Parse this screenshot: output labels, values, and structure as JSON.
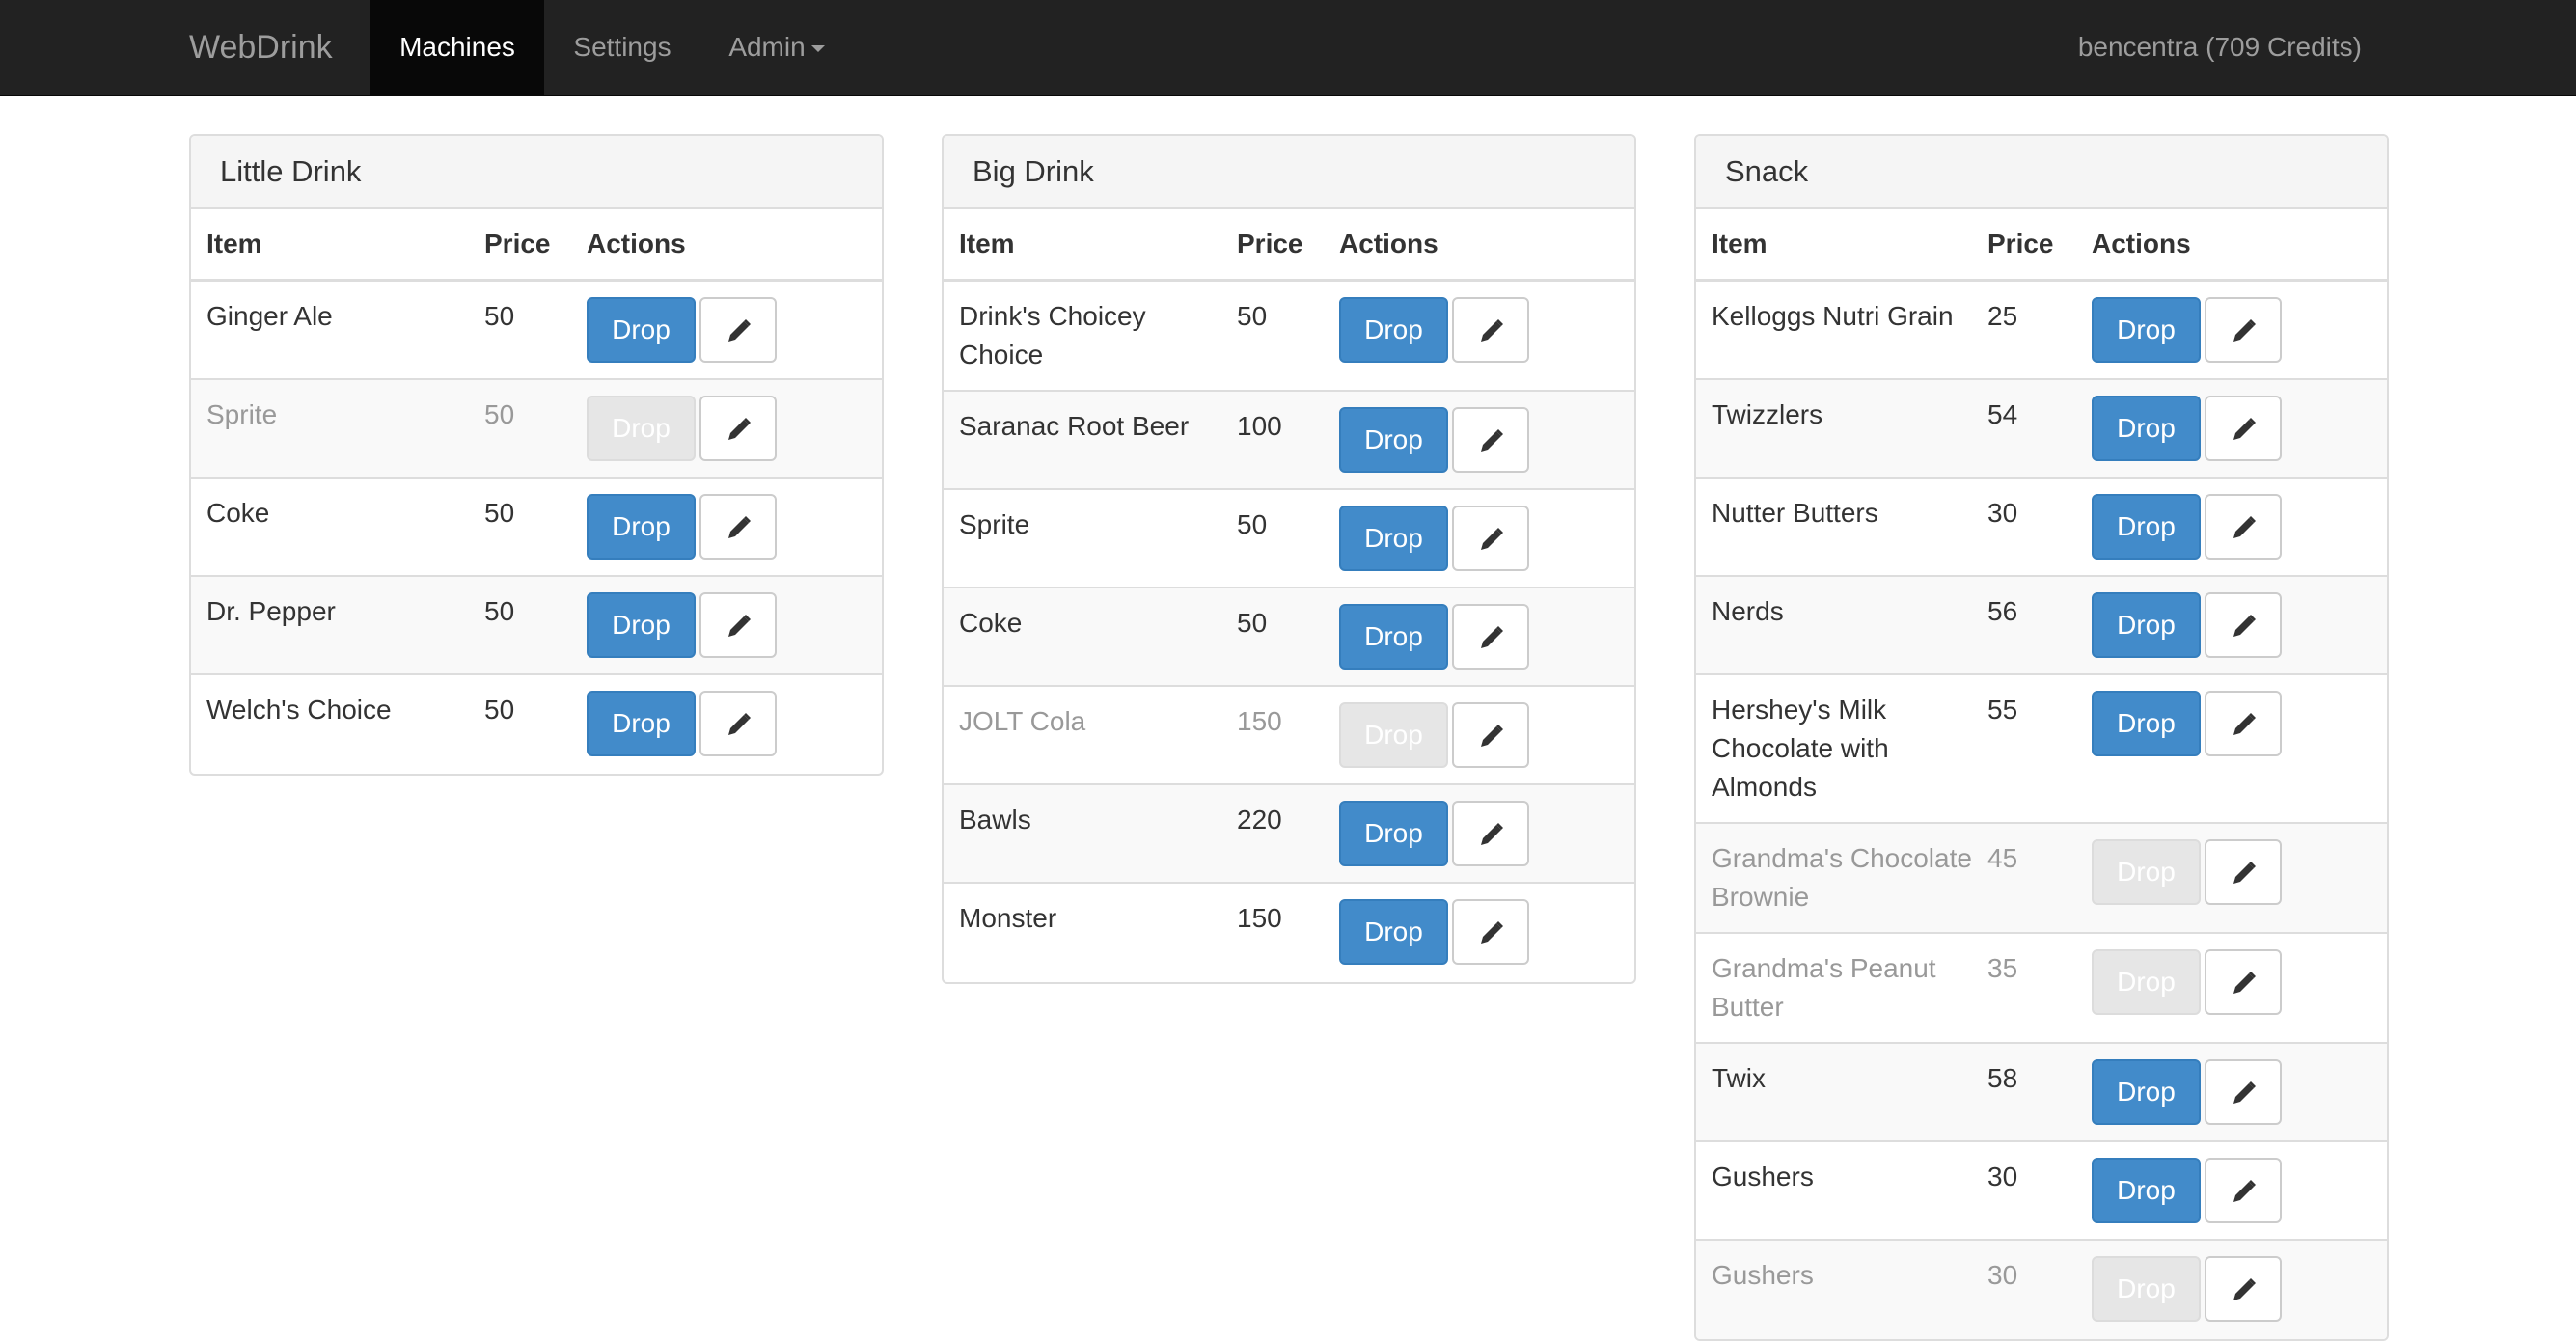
{
  "nav": {
    "brand": "WebDrink",
    "items": [
      {
        "label": "Machines"
      },
      {
        "label": "Settings"
      },
      {
        "label": "Admin"
      }
    ],
    "user": "bencentra (709 Credits)"
  },
  "headers": {
    "item": "Item",
    "price": "Price",
    "actions": "Actions"
  },
  "drop_label": "Drop",
  "icons": {
    "edit": "pencil-icon",
    "admin_dropdown": "caret-down-icon"
  },
  "colors": {
    "primary": "#428bca",
    "navbar": "#222222",
    "disabled": "#999999"
  },
  "machines": [
    {
      "title": "Little Drink",
      "items": [
        {
          "name": "Ginger Ale",
          "price": "50",
          "available": true
        },
        {
          "name": "Sprite",
          "price": "50",
          "available": false
        },
        {
          "name": "Coke",
          "price": "50",
          "available": true
        },
        {
          "name": "Dr. Pepper",
          "price": "50",
          "available": true
        },
        {
          "name": "Welch's Choice",
          "price": "50",
          "available": true
        }
      ]
    },
    {
      "title": "Big Drink",
      "items": [
        {
          "name": "Drink's Choicey Choice",
          "price": "50",
          "available": true
        },
        {
          "name": "Saranac Root Beer",
          "price": "100",
          "available": true
        },
        {
          "name": "Sprite",
          "price": "50",
          "available": true
        },
        {
          "name": "Coke",
          "price": "50",
          "available": true
        },
        {
          "name": "JOLT Cola",
          "price": "150",
          "available": false
        },
        {
          "name": "Bawls",
          "price": "220",
          "available": true
        },
        {
          "name": "Monster",
          "price": "150",
          "available": true
        }
      ]
    },
    {
      "title": "Snack",
      "items": [
        {
          "name": "Kelloggs Nutri Grain",
          "price": "25",
          "available": true
        },
        {
          "name": "Twizzlers",
          "price": "54",
          "available": true
        },
        {
          "name": "Nutter Butters",
          "price": "30",
          "available": true
        },
        {
          "name": "Nerds",
          "price": "56",
          "available": true
        },
        {
          "name": "Hershey's Milk Chocolate with Almonds",
          "price": "55",
          "available": true
        },
        {
          "name": "Grandma's Chocolate Brownie",
          "price": "45",
          "available": false
        },
        {
          "name": "Grandma's Peanut Butter",
          "price": "35",
          "available": false
        },
        {
          "name": "Twix",
          "price": "58",
          "available": true
        },
        {
          "name": "Gushers",
          "price": "30",
          "available": true
        },
        {
          "name": "Gushers",
          "price": "30",
          "available": false
        }
      ]
    }
  ]
}
